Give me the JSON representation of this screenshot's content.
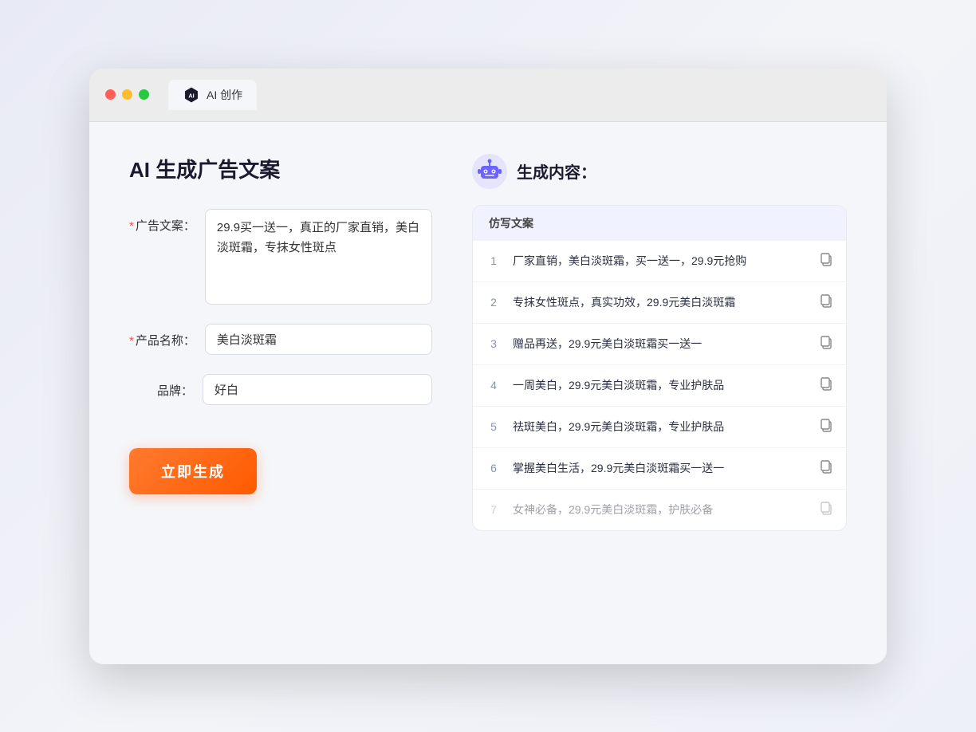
{
  "browser": {
    "tab_label": "AI 创作"
  },
  "page": {
    "title": "AI 生成广告文案"
  },
  "form": {
    "ad_copy_label": "广告文案：",
    "ad_copy_required": "*",
    "ad_copy_value": "29.9买一送一，真正的厂家直销，美白淡斑霜，专抹女性斑点",
    "product_name_label": "产品名称：",
    "product_name_required": "*",
    "product_name_value": "美白淡斑霜",
    "brand_label": "品牌：",
    "brand_value": "好白",
    "generate_button": "立即生成"
  },
  "result": {
    "header_title": "生成内容：",
    "table_header": "仿写文案",
    "items": [
      {
        "id": 1,
        "text": "厂家直销，美白淡斑霜，买一送一，29.9元抢购",
        "dimmed": false
      },
      {
        "id": 2,
        "text": "专抹女性斑点，真实功效，29.9元美白淡斑霜",
        "dimmed": false
      },
      {
        "id": 3,
        "text": "赠品再送，29.9元美白淡斑霜买一送一",
        "dimmed": false
      },
      {
        "id": 4,
        "text": "一周美白，29.9元美白淡斑霜，专业护肤品",
        "dimmed": false
      },
      {
        "id": 5,
        "text": "祛斑美白，29.9元美白淡斑霜，专业护肤品",
        "dimmed": false
      },
      {
        "id": 6,
        "text": "掌握美白生活，29.9元美白淡斑霜买一送一",
        "dimmed": false
      },
      {
        "id": 7,
        "text": "女神必备，29.9元美白淡斑霜，护肤必备",
        "dimmed": true
      }
    ]
  }
}
